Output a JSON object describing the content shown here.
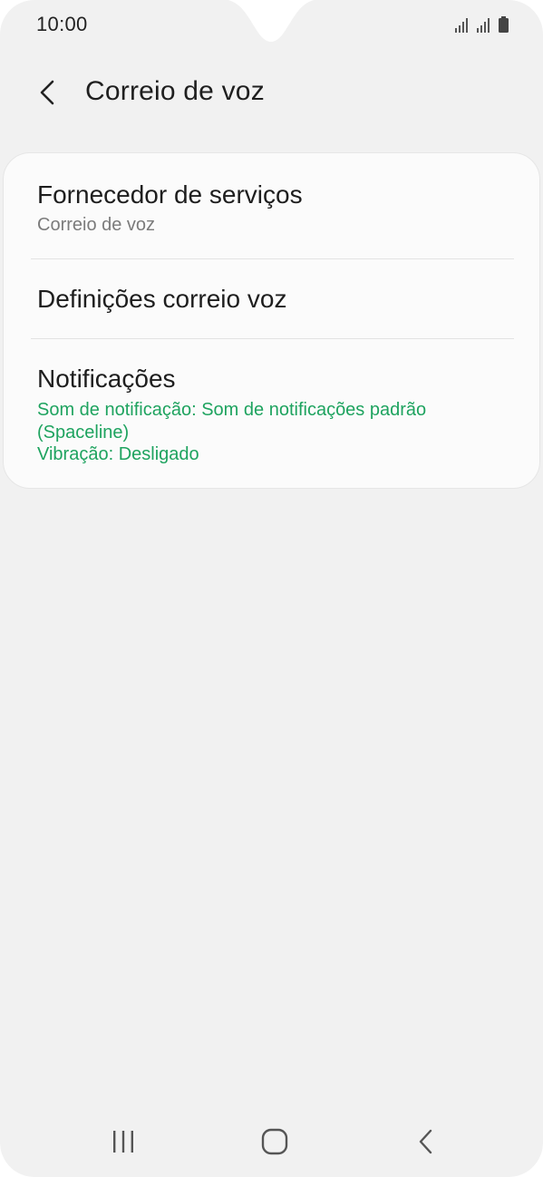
{
  "status_bar": {
    "time": "10:00",
    "icons": [
      "signal-icon-sim1",
      "signal-icon-sim2",
      "battery-icon"
    ]
  },
  "header": {
    "back_icon": "chevron-left-icon",
    "title": "Correio de voz"
  },
  "settings": {
    "items": [
      {
        "title": "Fornecedor de serviços",
        "subtitle": "Correio de voz"
      },
      {
        "title": "Definições correio voz"
      },
      {
        "title": "Notificações",
        "detail_line1": "Som de notificação: Som de notificações padrão (Spaceline)",
        "detail_line2": "Vibração: Desligado"
      }
    ]
  },
  "navigation": {
    "recents_icon": "recent-apps-icon",
    "home_icon": "home-icon",
    "back_icon": "back-icon"
  },
  "colors": {
    "background": "#f1f1f1",
    "card": "#fbfbfb",
    "accent_green": "#1ea35f",
    "text_primary": "#1e1e1e",
    "text_secondary": "#7b7b7b"
  }
}
